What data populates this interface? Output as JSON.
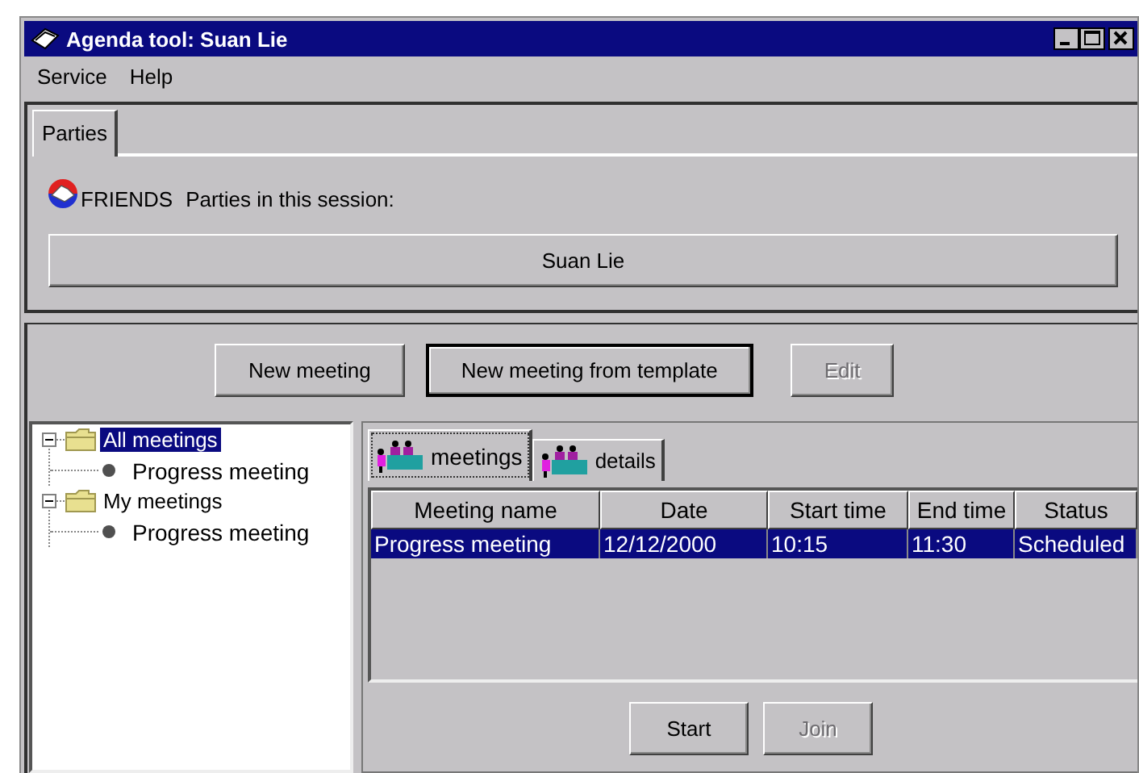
{
  "window": {
    "title": "Agenda tool: Suan Lie"
  },
  "menu": [
    "Service",
    "Help"
  ],
  "top_tabs": [
    {
      "label": "Parties",
      "selected": true
    }
  ],
  "friends_label": "FRIENDS",
  "parties_label": "Parties in this session:",
  "parties": [
    "Suan Lie"
  ],
  "toolbar": [
    {
      "label": "New meeting",
      "disabled": false,
      "focused": false
    },
    {
      "label": "New meeting from template",
      "disabled": false,
      "focused": true
    },
    {
      "label": "Edit",
      "disabled": true,
      "focused": false
    }
  ],
  "tree": [
    {
      "label": "All meetings",
      "selected": true,
      "expanded": true,
      "children": [
        {
          "label": "Progress meeting",
          "selected": false
        }
      ]
    },
    {
      "label": "My meetings",
      "selected": false,
      "expanded": true,
      "children": [
        {
          "label": "Progress meeting",
          "selected": false
        }
      ]
    }
  ],
  "view_tabs": [
    {
      "label": "meetings",
      "selected": true
    },
    {
      "label": "details",
      "selected": false
    }
  ],
  "table": {
    "columns": [
      "Meeting name",
      "Date",
      "Start time",
      "End time",
      "Status"
    ],
    "rows": [
      {
        "cells": [
          "Progress meeting",
          "12/12/2000",
          "10:15",
          "11:30",
          "Scheduled"
        ],
        "selected": true
      }
    ]
  },
  "actions": [
    {
      "label": "Start",
      "disabled": false
    },
    {
      "label": "Join",
      "disabled": true
    }
  ]
}
